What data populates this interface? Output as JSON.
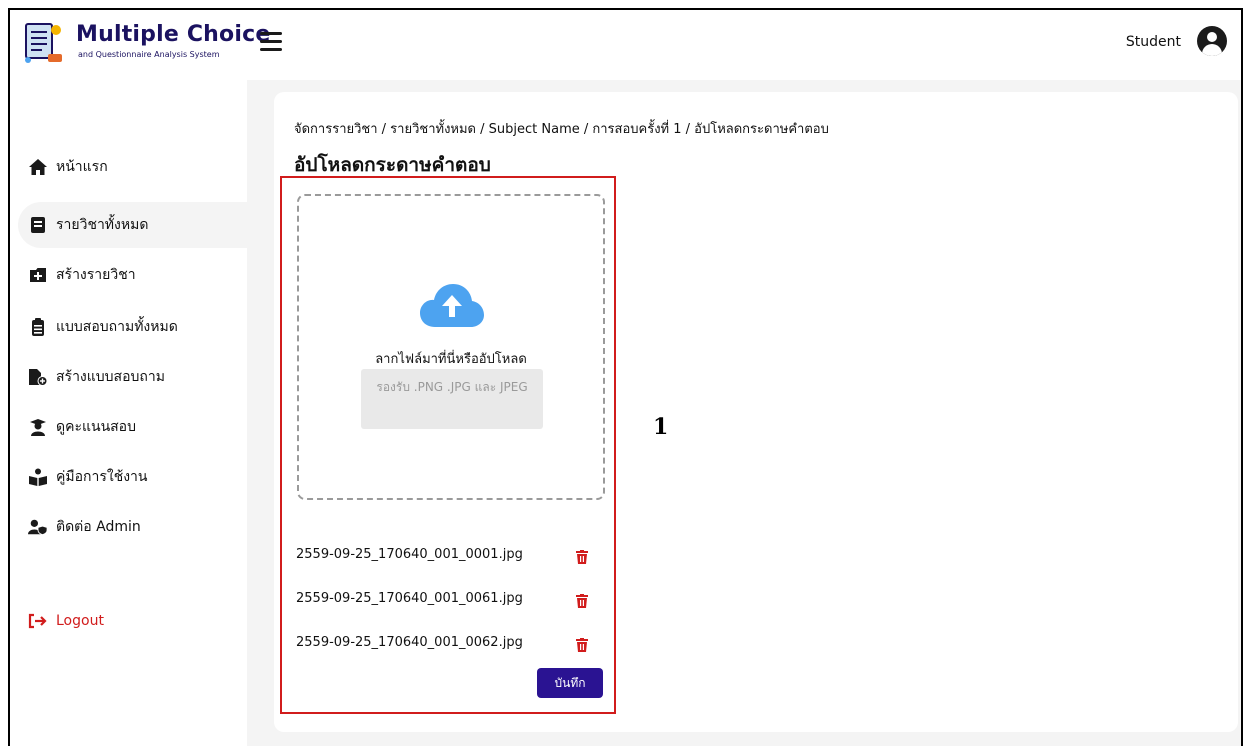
{
  "app": {
    "title": "Multiple Choice",
    "subtitle": "and Questionnaire Analysis System"
  },
  "header": {
    "user_label": "Student"
  },
  "sidebar": {
    "items": [
      {
        "label": "หน้าแรก",
        "icon": "home-icon"
      },
      {
        "label": "รายวิชาทั้งหมด",
        "icon": "book-icon",
        "active": true
      },
      {
        "label": "สร้างรายวิชา",
        "icon": "plus-square-icon"
      },
      {
        "label": "แบบสอบถามทั้งหมด",
        "icon": "clipboard-list-icon"
      },
      {
        "label": "สร้างแบบสอบถาม",
        "icon": "file-plus-icon"
      },
      {
        "label": "ดูคะแนนสอบ",
        "icon": "graduate-icon"
      },
      {
        "label": "คู่มือการใช้งาน",
        "icon": "reading-user-icon"
      },
      {
        "label": "ติดต่อ Admin",
        "icon": "user-shield-icon"
      }
    ],
    "logout_label": "Logout"
  },
  "main": {
    "breadcrumb": "จัดการรายวิชา / รายวิชาทั้งหมด / Subject Name / การสอบครั้งที่ 1 / อัปโหลดกระดาษคำตอบ",
    "title": "อัปโหลดกระดาษคำตอบ",
    "dropzone": {
      "text": "ลากไฟล์มาที่นี่หรืออัปโหลด",
      "hint": "รองรับ .PNG .JPG และ JPEG"
    },
    "files": [
      "2559-09-25_170640_001_0001.jpg",
      "2559-09-25_170640_001_0061.jpg",
      "2559-09-25_170640_001_0062.jpg"
    ],
    "save_label": "บันทึก"
  },
  "annotation": "1",
  "colors": {
    "brand": "#1b1260",
    "primary_button": "#2a1392",
    "danger": "#d11c1c",
    "cloud": "#4da3f0"
  }
}
